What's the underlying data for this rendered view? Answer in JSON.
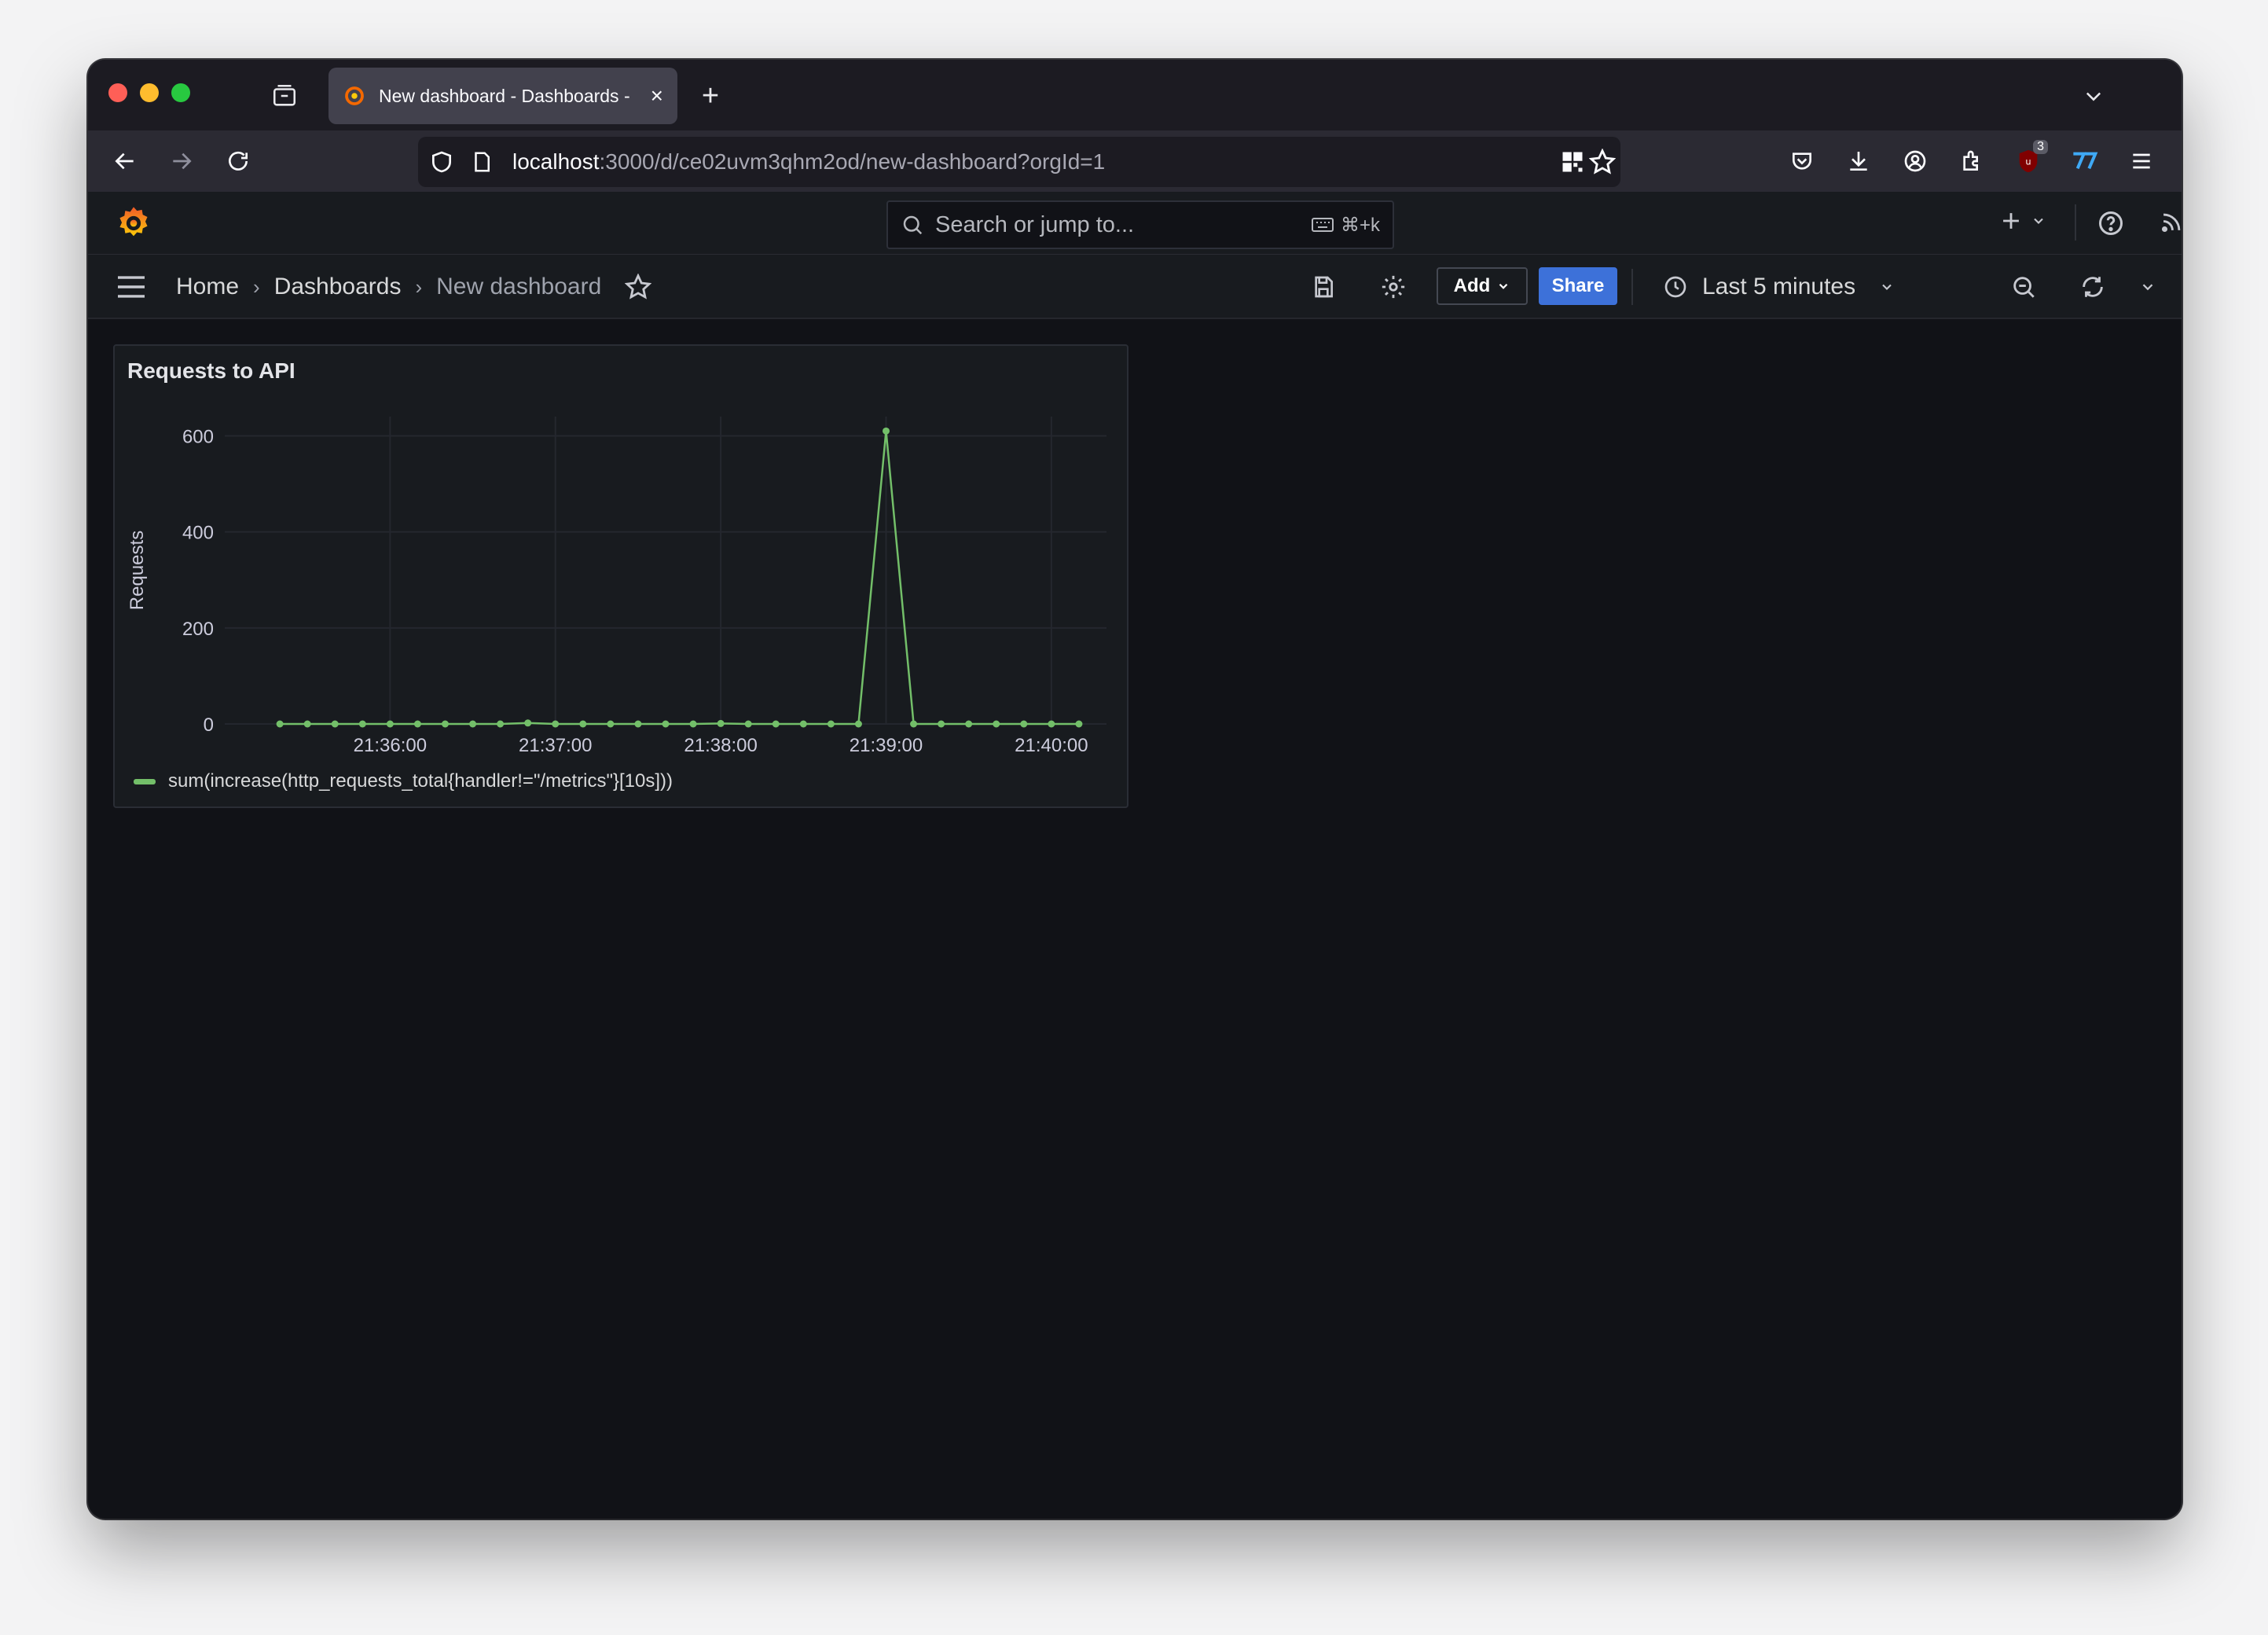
{
  "browser": {
    "tab_title": "New dashboard - Dashboards -",
    "url_host": "localhost",
    "url_path": ":3000/d/ce02uvm3qhm2od/new-dashboard?orgId=1",
    "extension_badge": "3"
  },
  "grafana": {
    "search_placeholder": "Search or jump to...",
    "search_shortcut": "⌘+k",
    "breadcrumbs": [
      "Home",
      "Dashboards",
      "New dashboard"
    ],
    "add_label": "Add",
    "share_label": "Share",
    "time_range": "Last 5 minutes"
  },
  "panel": {
    "title": "Requests to API",
    "legend": "sum(increase(http_requests_total{handler!=\"/metrics\"}[10s]))",
    "series_color": "#73bf69"
  },
  "chart_data": {
    "type": "line",
    "title": "Requests to API",
    "xlabel": "",
    "ylabel": "Requests",
    "y_ticks": [
      0,
      200,
      400,
      600
    ],
    "ylim": [
      0,
      640
    ],
    "x_tick_labels": [
      "21:36:00",
      "21:37:00",
      "21:38:00",
      "21:39:00",
      "21:40:00"
    ],
    "x_tick_times": [
      "21:36:00",
      "21:37:00",
      "21:38:00",
      "21:39:00",
      "21:40:00"
    ],
    "grid": true,
    "legend_placement": "bottom-left",
    "series": [
      {
        "name": "sum(increase(http_requests_total{handler!=\"/metrics\"}[10s]))",
        "times": [
          "21:35:20",
          "21:35:30",
          "21:35:40",
          "21:35:50",
          "21:36:00",
          "21:36:10",
          "21:36:20",
          "21:36:30",
          "21:36:40",
          "21:36:50",
          "21:37:00",
          "21:37:10",
          "21:37:20",
          "21:37:30",
          "21:37:40",
          "21:37:50",
          "21:38:00",
          "21:38:10",
          "21:38:20",
          "21:38:30",
          "21:38:40",
          "21:38:50",
          "21:39:00",
          "21:39:10",
          "21:39:20",
          "21:39:30",
          "21:39:40",
          "21:39:50",
          "21:40:00",
          "21:40:10"
        ],
        "values": [
          0,
          0,
          0,
          0,
          0,
          0,
          0,
          0,
          0,
          2,
          0,
          0,
          0,
          0,
          0,
          0,
          1,
          0,
          0,
          0,
          0,
          0,
          610,
          0,
          0,
          0,
          0,
          0,
          0,
          0
        ]
      }
    ]
  }
}
